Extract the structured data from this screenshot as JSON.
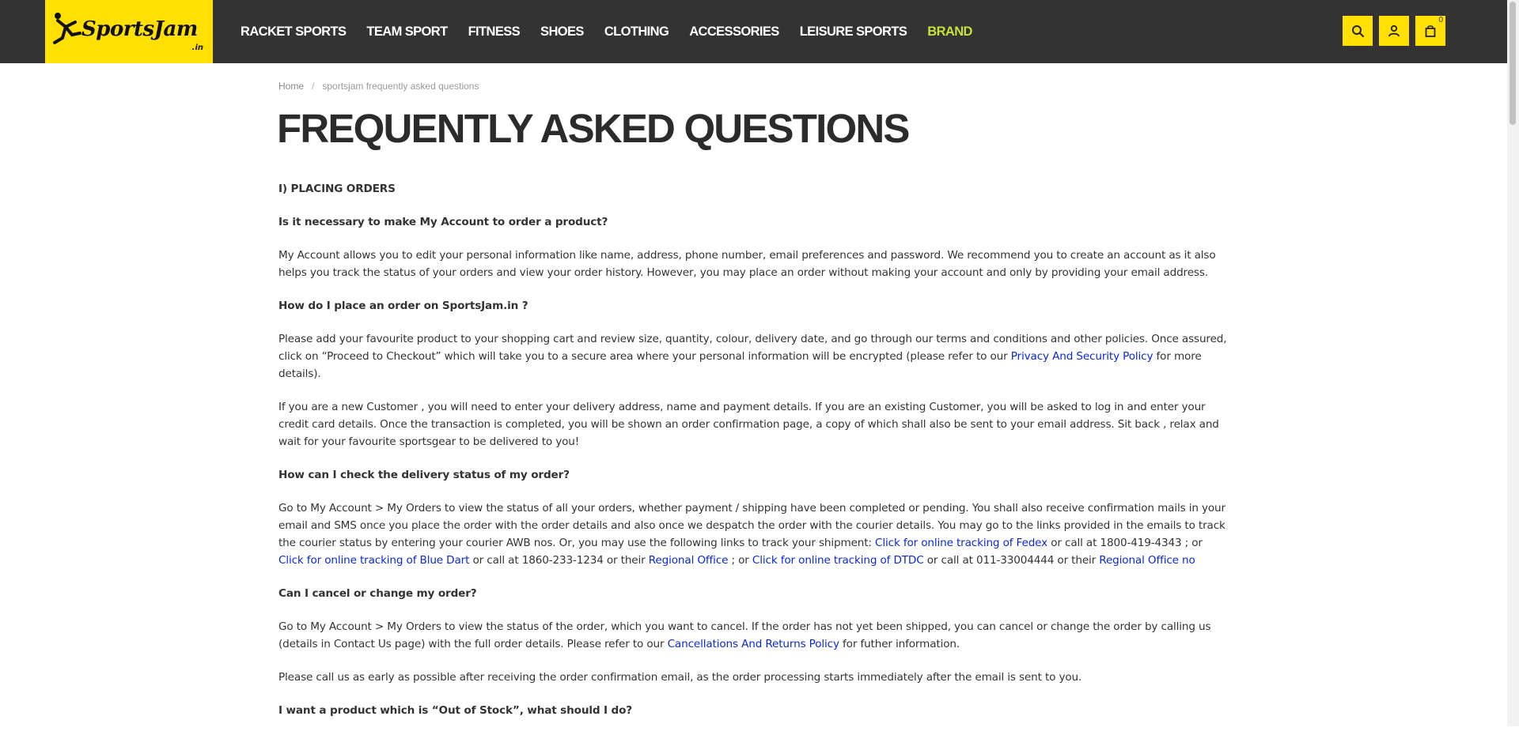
{
  "header": {
    "logo_text": "SportsJam",
    "logo_sub": ".in",
    "nav": [
      {
        "label": "RACKET SPORTS"
      },
      {
        "label": "TEAM SPORT"
      },
      {
        "label": "FITNESS"
      },
      {
        "label": "SHOES"
      },
      {
        "label": "CLOTHING"
      },
      {
        "label": "ACCESSORIES"
      },
      {
        "label": "LEISURE SPORTS"
      },
      {
        "label": "BRAND"
      }
    ],
    "cart_count": "0"
  },
  "breadcrumb": {
    "home": "Home",
    "separator": "/",
    "current": "sportsjam frequently asked questions"
  },
  "page_title": "FREQUENTLY ASKED QUESTIONS",
  "faq": {
    "section1": "I) PLACING ORDERS",
    "q1": "Is it necessary to make My Account to order a product?",
    "a1": "My Account allows you to edit your personal information like name, address, phone number, email preferences and password. We recommend you to create an account as it also helps you track the status of your orders and view your order history. However, you may place an order without making your account and only by providing your email address.",
    "q2": "How do I place an order on SportsJam.in ?",
    "a2_p1_before": "Please add your favourite product to your shopping cart and review size, quantity, colour, delivery date, and go through our terms and conditions and other policies. Once assured, click on “Proceed to Checkout” which will take you to a secure area where your personal information will be encrypted (please refer to our ",
    "a2_p1_link": "Privacy And Security Policy",
    "a2_p1_after": " for more details).",
    "a2_p2": "If you are a new Customer , you will need to enter your delivery address, name and payment details. If you are an existing Customer, you will be asked to log in and enter your credit card details. Once the transaction is completed, you will be shown an order confirmation page, a copy of which shall also be sent to your email address. Sit back , relax and wait for your favourite sportsgear to be delivered to you!",
    "q3": "How can I check the delivery status of my order?",
    "a3_t1": "Go to My Account > My Orders to view the status of all your orders, whether payment / shipping have been completed or pending. You shall also receive confirmation mails in your email and SMS once you place the order with the order details and also once we despatch the order with the courier details. You may go to the links provided in the emails to track the courier status by entering your courier AWB nos. Or, you may use the following links to track your shipment: ",
    "a3_l1": "Click for online tracking of Fedex",
    "a3_t2": " or call at 1800-419-4343 ; or ",
    "a3_l2": "Click for online tracking of Blue Dart",
    "a3_t3": " or call at 1860-233-1234 or their ",
    "a3_l3": "Regional Office",
    "a3_t4": " ; or ",
    "a3_l4": "Click for online tracking of DTDC",
    "a3_t5": " or call at 011-33004444 or their ",
    "a3_l5": "Regional Office no",
    "q4": "Can I cancel or change my order?",
    "a4_p1_before": "Go to My Account > My Orders to view the status of the order, which you want to cancel. If the order has not yet been shipped, you can cancel or change the order by calling us (details in Contact Us page) with the full order details. Please refer to our ",
    "a4_p1_link": "Cancellations And Returns Policy",
    "a4_p1_after": " for futher information.",
    "a4_p2": "Please call us as early as possible after receiving the order confirmation email, as the order processing starts immediately after the email is sent to you.",
    "q5": "I want a product which is “Out of Stock”, what should I do?"
  },
  "icons": {
    "search": "search-icon",
    "account": "user-icon",
    "cart": "shopping-bag-icon",
    "logo_figure": "player-kick-icon"
  },
  "colors": {
    "header_bg": "#333333",
    "accent_yellow": "#ffe000",
    "brand_green": "#c8e03a",
    "link_blue": "#0b29d6"
  }
}
